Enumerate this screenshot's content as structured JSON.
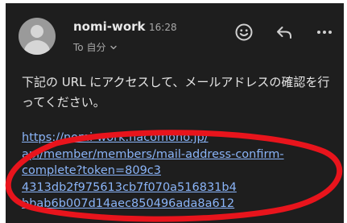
{
  "message": {
    "sender_name": "nomi-work",
    "time": "16:28",
    "recipient_label": "To 自分",
    "body_text": "下記の URL にアクセスして、メールアドレスの確認を行ってください。",
    "link_lines": [
      "https://nomi-work.hacomono.jp/",
      "api/member/members/mail-address-confirm-",
      "complete?token=809c3",
      "4313db2f975613cb7f070a516831b4",
      "bbab6b007d14aec850496ada8a612"
    ]
  },
  "icons": {
    "emoji": "smiley-icon",
    "reply": "reply-arrow-icon",
    "more": "more-horizontal-icon",
    "expand": "chevron-down-icon",
    "avatar": "default-avatar"
  },
  "colors": {
    "background": "#1e1e1e",
    "link": "#8ab4f8",
    "annotation": "#e8141c"
  }
}
